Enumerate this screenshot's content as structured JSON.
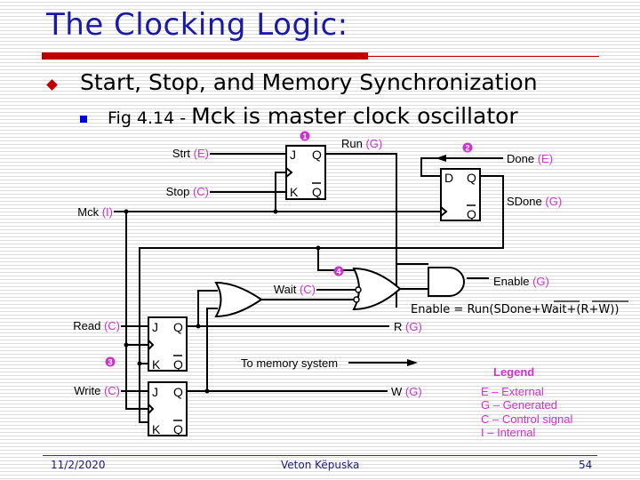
{
  "slide": {
    "title": "The Clocking Logic:",
    "bullet1": "Start, Stop, and Memory Synchronization",
    "bullet2_small": "Fig 4.14 - ",
    "bullet2_big": "Mck is master clock oscillator"
  },
  "diagram": {
    "signals": {
      "strt": {
        "name": "Strt ",
        "type": "(E)"
      },
      "stop": {
        "name": "Stop ",
        "type": "(C)"
      },
      "mck": {
        "name": "Mck ",
        "type": "(I)"
      },
      "run": {
        "name": "Run ",
        "type": "(G)"
      },
      "done": {
        "name": "Done ",
        "type": "(E)"
      },
      "sdone": {
        "name": "SDone ",
        "type": "(G)"
      },
      "wait": {
        "name": "Wait ",
        "type": "(C)"
      },
      "enable": {
        "name": "Enable ",
        "type": "(G)"
      },
      "read": {
        "name": "Read ",
        "type": "(C)"
      },
      "write": {
        "name": "Write ",
        "type": "(C)"
      },
      "r": {
        "name": "R ",
        "type": "(G)"
      },
      "w": {
        "name": "W ",
        "type": "(G)"
      }
    },
    "ff_pins": {
      "j": "J",
      "k": "K",
      "q": "Q",
      "qbar": "Q",
      "d": "D"
    },
    "markers": [
      "1",
      "2",
      "3",
      "4"
    ],
    "to_memory": "To memory system",
    "equation": {
      "prefix": "Enable = Run(SDone+",
      "wait_bar": "Wait",
      "mid": "+",
      "rw_bar": "(R+W)",
      "suffix": ")"
    }
  },
  "legend": {
    "title": "Legend",
    "items": [
      "E – External",
      "G – Generated",
      "C – Control signal",
      "I  – Internal"
    ]
  },
  "footer": {
    "date": "11/2/2020",
    "author": "Veton Këpuska",
    "page": "54"
  },
  "colors": {
    "title": "#1a1aa6",
    "accent_red": "#c00000",
    "signal_type": "#cc33cc"
  }
}
